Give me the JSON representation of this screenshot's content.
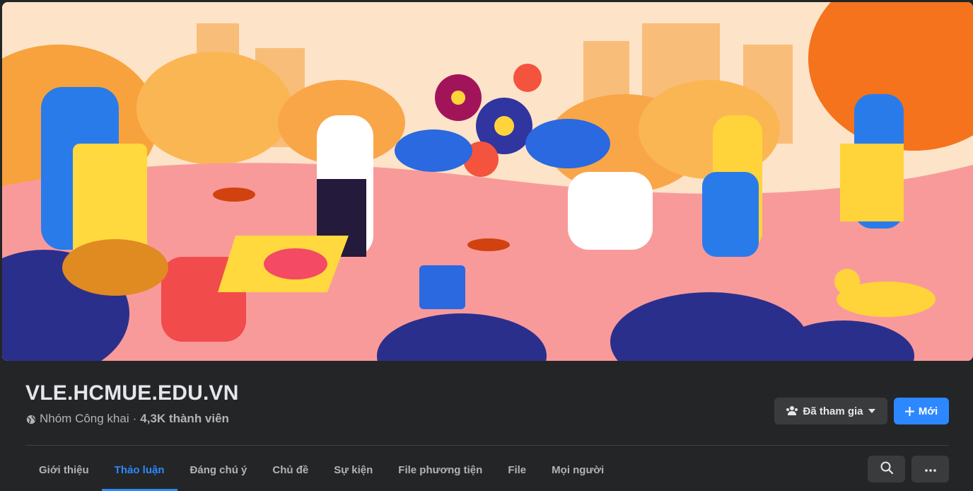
{
  "group": {
    "name": "VLE.HCMUE.EDU.VN",
    "privacy": "Nhóm Công khai",
    "separator": "·",
    "members": "4,3K thành viên"
  },
  "actions": {
    "joined_label": "Đã tham gia",
    "new_label": "Mới"
  },
  "tabs": [
    {
      "label": "Giới thiệu",
      "active": false
    },
    {
      "label": "Thảo luận",
      "active": true
    },
    {
      "label": "Đáng chú ý",
      "active": false
    },
    {
      "label": "Chủ đề",
      "active": false
    },
    {
      "label": "Sự kiện",
      "active": false
    },
    {
      "label": "File phương tiện",
      "active": false
    },
    {
      "label": "File",
      "active": false
    },
    {
      "label": "Mọi người",
      "active": false
    }
  ],
  "icons": {
    "privacy": "globe-icon",
    "joined": "people-icon",
    "dropdown": "caret-down-icon",
    "new": "plus-icon",
    "search": "search-icon",
    "more": "more-horizontal-icon"
  },
  "colors": {
    "accent": "#2d88ff",
    "background": "#242526",
    "button": "#3a3b3c"
  }
}
